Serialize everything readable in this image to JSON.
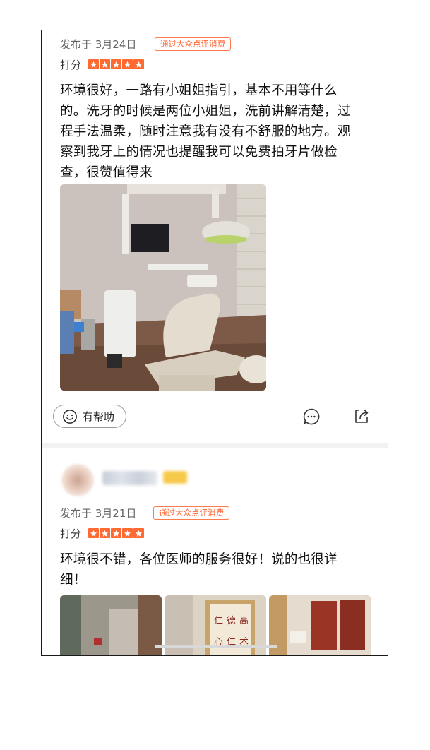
{
  "reviews": [
    {
      "date": "发布于 3月24日",
      "badge": "通过大众点评消费",
      "score_label": "打分",
      "stars": 5,
      "text_lines": [
        "环境很好，一路有小姐姐指引，基本不用等什么",
        "的。洗牙的时候是两位小姐姐，洗前讲解清楚，过",
        "程手法温柔，随时注意我有没有不舒服的地方。观",
        "察到我牙上的情况也提醒我可以免费拍牙片做检",
        "查，很赞值得来"
      ],
      "helpful_label": "有帮助"
    },
    {
      "date": "发布于 3月21日",
      "badge": "通过大众点评消费",
      "score_label": "打分",
      "stars": 5,
      "text_lines": [
        "环境很不错，各位医师的服务很好！说的也很详",
        "细！"
      ]
    }
  ],
  "icons": [
    "smile-icon",
    "comment-icon",
    "share-icon",
    "star-icon"
  ],
  "colors": {
    "accent": "#ff6a33",
    "badge_border": "#ff7a4d"
  }
}
